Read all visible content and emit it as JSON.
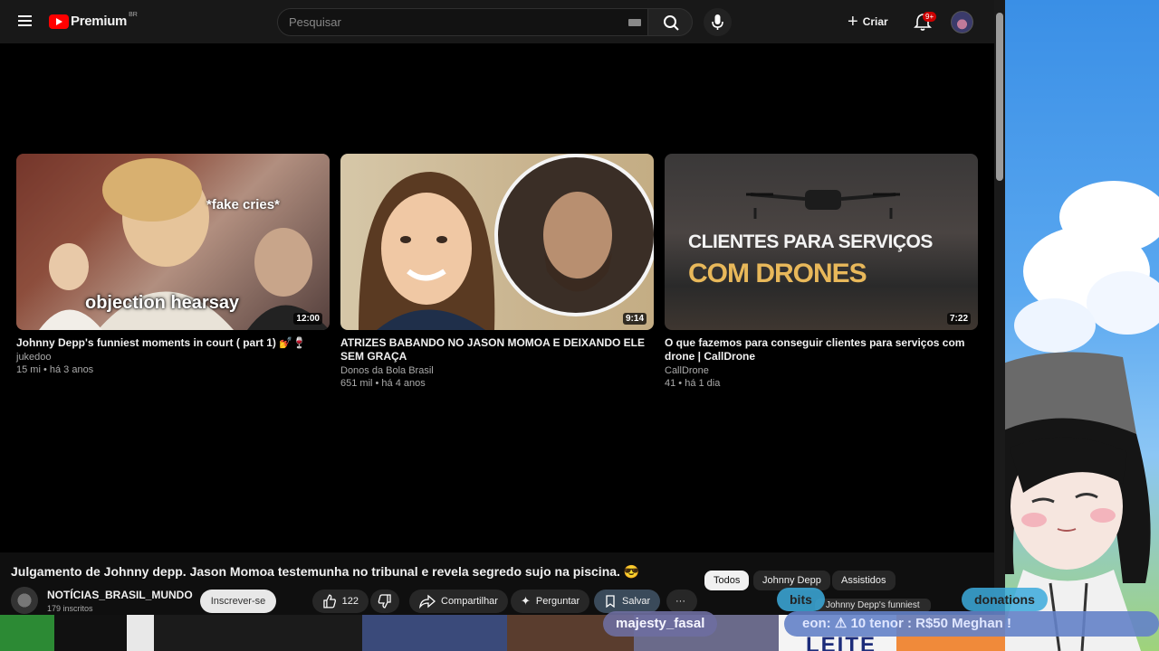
{
  "header": {
    "logo_word": "Premium",
    "logo_country": "BR",
    "search_placeholder": "Pesquisar",
    "create_label": "Criar",
    "notif_badge": "9+"
  },
  "videos": [
    {
      "thumb_caption": "*fake cries*",
      "thumb_caption2": "objection hearsay",
      "duration": "12:00",
      "title": "Johnny Depp's funniest moments in court ( part 1) 💅🍷",
      "channel": "jukedoo",
      "meta": "15 mi • há 3 anos"
    },
    {
      "duration": "9:14",
      "title": "ATRIZES BABANDO NO JASON MOMOA E DEIXANDO ELE SEM GRAÇA",
      "channel": "Donos da Bola Brasil",
      "meta": "651 mil • há 4 anos"
    },
    {
      "thumb_caption": "CLIENTES PARA SERVIÇOS",
      "thumb_caption2": "COM DRONES",
      "duration": "7:22",
      "title": "O que fazemos para conseguir clientes para serviços com drone | CallDrone",
      "channel": "CallDrone",
      "meta": "41 • há 1 dia"
    }
  ],
  "now_playing": {
    "title": "Julgamento de Johnny depp. Jason Momoa testemunha no tribunal e revela segredo sujo na piscina. 😎",
    "channel": "NOTÍCIAS_BRASIL_MUNDO",
    "subs": "179 inscritos",
    "subscribe_label": "Inscrever-se",
    "likes": "122",
    "share_label": "Compartilhar",
    "ask_label": "Perguntar",
    "save_label": "Salvar"
  },
  "chips": [
    "Todos",
    "Johnny Depp",
    "Assistidos"
  ],
  "stream_overlay": {
    "username": "majesty_fasal",
    "bits_label": "bits",
    "donations_label": "donations",
    "ticker": "eon: ⚠ 10   tenor   : R$50   Meghan !",
    "mini_title": "Johnny Depp's funniest",
    "leite": "LEITE"
  },
  "colors": {
    "accent": "#ff0000",
    "badge": "#cc0000",
    "background": "#000000"
  }
}
